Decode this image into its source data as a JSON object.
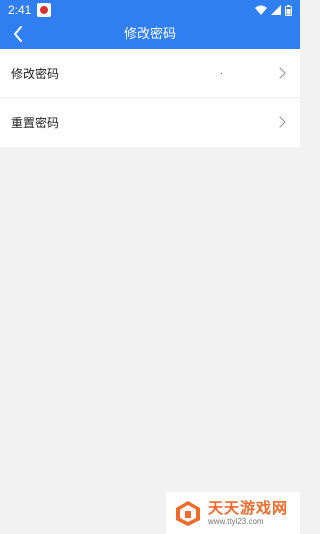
{
  "status_bar": {
    "time": "2:41",
    "icons": [
      "app-notification-icon",
      "wifi-icon",
      "signal-icon",
      "battery-icon"
    ]
  },
  "app_bar": {
    "title": "修改密码",
    "back_icon": "back-arrow-icon",
    "color": "#2f7ff0"
  },
  "menu": {
    "items": [
      {
        "label": "修改密码",
        "icon": "chevron-right-icon"
      },
      {
        "label": "重置密码",
        "icon": "chevron-right-icon"
      }
    ]
  },
  "watermark": {
    "brand": "天天游戏网",
    "url": "www.ttyl23.com",
    "color": "#f26a2a"
  }
}
